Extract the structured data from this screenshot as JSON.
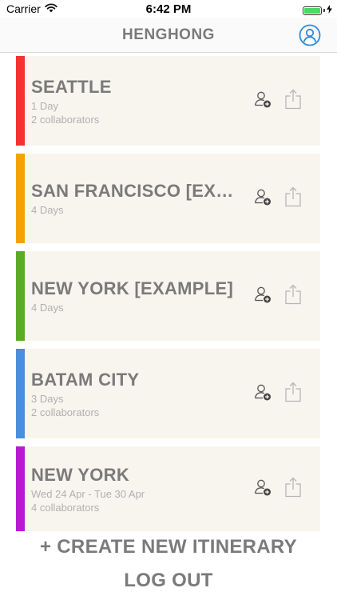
{
  "status_bar": {
    "carrier": "Carrier",
    "time": "6:42 PM",
    "battery_level": 1.0
  },
  "nav": {
    "title": "HENGHONG",
    "profile_icon": "user-circle-icon"
  },
  "itineraries": [
    {
      "title": "SEATTLE",
      "subtitle": "1 Day",
      "collaborators": "2 collaborators",
      "color": "#f5322f"
    },
    {
      "title": "SAN FRANCISCO [EXA...",
      "subtitle": "4 Days",
      "collaborators": "",
      "color": "#f5a300"
    },
    {
      "title": "NEW YORK [EXAMPLE]",
      "subtitle": "4 Days",
      "collaborators": "",
      "color": "#5aac25"
    },
    {
      "title": "BATAM CITY",
      "subtitle": "3 Days",
      "collaborators": "2 collaborators",
      "color": "#4a8fdd"
    },
    {
      "title": "NEW YORK",
      "subtitle": "Wed 24 Apr - Tue 30 Apr",
      "collaborators": "4 collaborators",
      "color": "#b81ad4"
    }
  ],
  "icons": {
    "add_collaborator": "add-user-icon",
    "share": "share-icon"
  },
  "actions": {
    "create_label": "+ CREATE NEW ITINERARY",
    "logout_label": "LOG OUT"
  }
}
